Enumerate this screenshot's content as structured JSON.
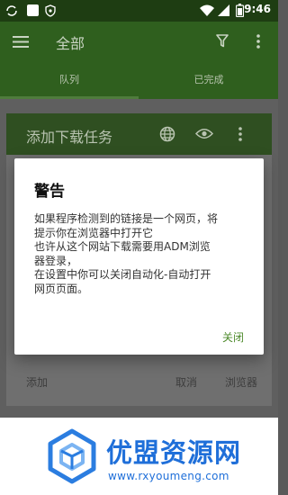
{
  "status_bar": {
    "time": "9:46",
    "icons": [
      "sync-icon",
      "square-icon",
      "shield-icon",
      "wifi-icon",
      "signal-icon",
      "battery-icon"
    ]
  },
  "app_bar": {
    "title": "全部",
    "icons": [
      "menu-icon",
      "filter-icon",
      "more-vert-icon"
    ]
  },
  "tabs": [
    {
      "label": "队列",
      "active": true
    },
    {
      "label": "已完成",
      "active": false
    }
  ],
  "background_sheet": {
    "title": "添加下载任务",
    "header_icons": [
      "globe-icon",
      "eye-icon",
      "more-vert-icon"
    ],
    "actions": [
      "添加",
      "取消",
      "浏览器"
    ]
  },
  "dialog": {
    "title": "警告",
    "message": "如果程序检测到的链接是一个网页，将\n提示你在浏览器中打开它\n也许从这个网站下载需要用ADM浏览\n器登录，\n在设置中你可以关闭自动化-自动打开\n网页页面。",
    "button": "关闭"
  },
  "watermark": {
    "brand": "优盟资源网",
    "url": "www.rxyoumeng.com"
  },
  "colors": {
    "status_bar": "#1e3d12",
    "app_bar": "#2f5f1e",
    "dialog_button": "#4e8a2c",
    "watermark": "#1f6fd9"
  }
}
